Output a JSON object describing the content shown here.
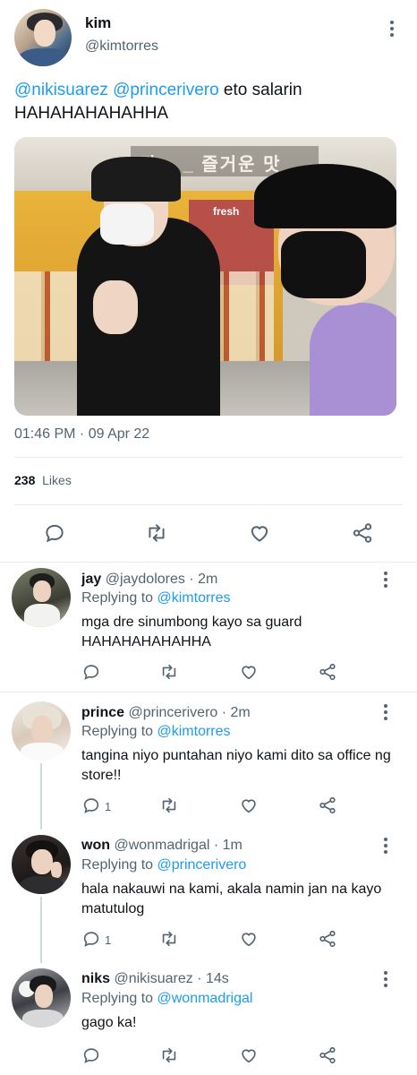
{
  "main_tweet": {
    "author_name": "kim",
    "author_handle": "@kimtorres",
    "text_mention_1": "@nikisuarez",
    "text_mention_2": "@princerivero",
    "text_rest": " eto salarin",
    "text_line2": "HAHAHAHAHAHHA",
    "photo_sign_text": "다 _ _ 즐거운 맛",
    "photo_sticker_text": "fresh",
    "timestamp": "01:46 PM · 09 Apr 22",
    "likes_count": "238",
    "likes_label": "Likes"
  },
  "replies": [
    {
      "name": "jay",
      "handle": "@jaydolores",
      "time": "· 2m",
      "replying_label": "Replying to",
      "replying_to": "@kimtorres",
      "text": "mga dre sinumbong kayo sa guard HAHAHAHAHAHHA",
      "reply_count": ""
    },
    {
      "name": "prince",
      "handle": "@princerivero",
      "time": "· 2m",
      "replying_label": "Replying to",
      "replying_to": "@kimtorres",
      "text": "tangina niyo puntahan niyo kami dito sa office ng store!!",
      "reply_count": "1"
    },
    {
      "name": "won",
      "handle": "@wonmadrigal",
      "time": "· 1m",
      "replying_label": "Replying to",
      "replying_to": "@princerivero",
      "text": "hala nakauwi na kami, akala namin jan na kayo matutulog",
      "reply_count": "1"
    },
    {
      "name": "niks",
      "handle": "@nikisuarez",
      "time": "· 14s",
      "replying_label": "Replying to",
      "replying_to": "@wonmadrigal",
      "text": "gago ka!",
      "reply_count": ""
    }
  ],
  "icons": [
    "reply-icon",
    "retweet-icon",
    "like-icon",
    "share-icon",
    "more-icon"
  ],
  "colors": {
    "accent": "#1d9bf0",
    "muted": "#536471",
    "text": "#0f1419",
    "divider": "#e6ecf0"
  }
}
